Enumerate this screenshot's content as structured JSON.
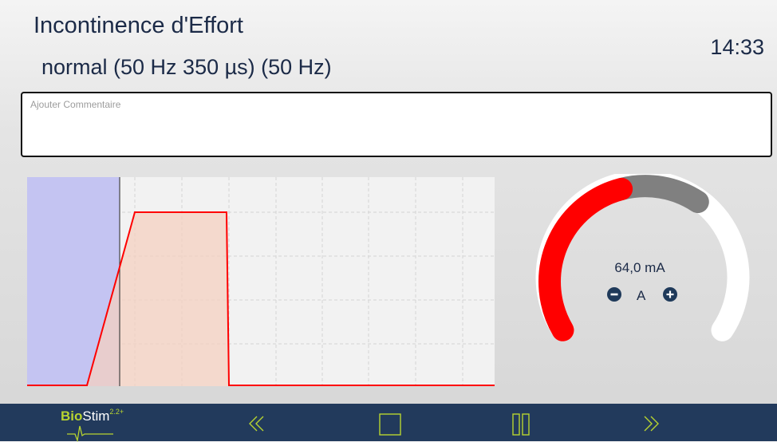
{
  "header": {
    "program_title": "Incontinence d'Effort",
    "program_params": "normal (50 Hz 350 µs) (50 Hz)",
    "clock": "14:33"
  },
  "comment": {
    "placeholder": "Ajouter Commentaire",
    "value": ""
  },
  "gauge": {
    "value_text": "64,0 mA",
    "channel_label": "A",
    "minus_icon": "minus-circle-icon",
    "plus_icon": "plus-circle-icon",
    "level_fraction": 0.45,
    "colors": {
      "active": "#ff0000",
      "pending": "#808080",
      "track": "#ffffff"
    }
  },
  "footer": {
    "brand_bio": "Bio",
    "brand_stim": "Stim",
    "brand_version": "2.2+",
    "buttons": [
      {
        "name": "rewind-button",
        "icon": "double-chevron-left-icon"
      },
      {
        "name": "stop-button",
        "icon": "stop-square-icon"
      },
      {
        "name": "pause-button",
        "icon": "pause-icon"
      },
      {
        "name": "forward-button",
        "icon": "double-chevron-right-icon"
      }
    ]
  },
  "colors": {
    "accent_blue": "#223a5c",
    "logo_green": "#b8d430",
    "waveform": "#ff0000",
    "phase_current": "#c4c4f2",
    "phase_ramp": "#f4d8cd"
  }
}
